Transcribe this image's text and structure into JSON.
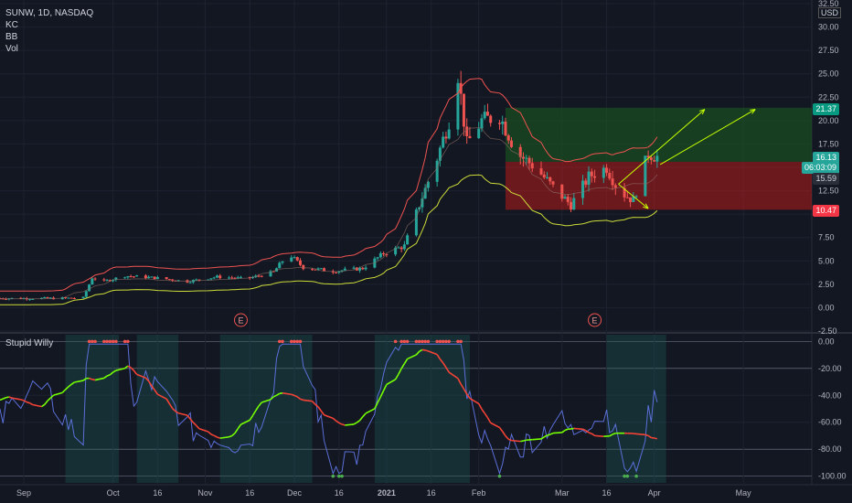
{
  "header": {
    "symbol": "SUNW, 1D, NASDAQ",
    "currency": "USD",
    "indicators": [
      "KC",
      "BB",
      "Vol"
    ],
    "sub_indicator": "Stupid Willy"
  },
  "price_tags": {
    "target": "21.37",
    "last": "16.13",
    "countdown": "06:03:09",
    "prev": "15.59",
    "stop": "10.47"
  },
  "colors": {
    "background": "#131722",
    "grid": "#1e2230",
    "up": "#26a69a",
    "down": "#ef5350",
    "kc": "#ef5350",
    "bb": "#cddc39",
    "profit_zone": "#1b5e20",
    "loss_zone": "#b71c1c",
    "arrow": "#c6ff00",
    "osc_fast": "#5b6fd8",
    "osc_slow_up": "#76ff03",
    "osc_slow_down": "#f44336"
  },
  "earnings_marker": "E",
  "chart_data": [
    {
      "type": "candlestick",
      "title": "SUNW, 1D, NASDAQ",
      "ylabel": "USD",
      "ylim": [
        -2.5,
        32.5
      ],
      "y_ticks": [
        "32.50",
        "30.00",
        "27.50",
        "25.00",
        "22.50",
        "20.00",
        "17.50",
        "15.00",
        "12.50",
        "10.00",
        "7.50",
        "5.00",
        "2.50",
        "0.00",
        "-2.50"
      ],
      "x_ticks": [
        "Sep",
        "Oct",
        "16",
        "Nov",
        "16",
        "Dec",
        "16",
        "2021",
        "16",
        "Feb",
        "Mar",
        "16",
        "Apr",
        "May"
      ],
      "x_range": [
        "2020-08-24",
        "2021-05-24"
      ],
      "price_path": [
        [
          "2020-08-24",
          1.0
        ],
        [
          "2020-09-10",
          1.0
        ],
        [
          "2020-09-21",
          1.05
        ],
        [
          "2020-09-24",
          3.2
        ],
        [
          "2020-09-28",
          2.8
        ],
        [
          "2020-10-05",
          3.4
        ],
        [
          "2020-10-15",
          3.2
        ],
        [
          "2020-10-26",
          2.8
        ],
        [
          "2020-11-05",
          3.3
        ],
        [
          "2020-11-15",
          3.1
        ],
        [
          "2020-11-24",
          3.8
        ],
        [
          "2020-11-29",
          5.8
        ],
        [
          "2020-12-04",
          4.3
        ],
        [
          "2020-12-14",
          3.9
        ],
        [
          "2020-12-24",
          4.2
        ],
        [
          "2020-12-31",
          5.8
        ],
        [
          "2021-01-07",
          6.6
        ],
        [
          "2021-01-12",
          11.0
        ],
        [
          "2021-01-18",
          16.0
        ],
        [
          "2021-01-22",
          20.0
        ],
        [
          "2021-01-25",
          25.0
        ],
        [
          "2021-01-28",
          17.5
        ],
        [
          "2021-02-02",
          20.0
        ],
        [
          "2021-02-08",
          20.5
        ],
        [
          "2021-02-14",
          16.5
        ],
        [
          "2021-02-20",
          15.0
        ],
        [
          "2021-02-27",
          12.5
        ],
        [
          "2021-03-04",
          11.0
        ],
        [
          "2021-03-10",
          14.0
        ],
        [
          "2021-03-16",
          15.0
        ],
        [
          "2021-03-20",
          12.5
        ],
        [
          "2021-03-25",
          11.5
        ],
        [
          "2021-03-30",
          16.5
        ],
        [
          "2021-04-02",
          16.13
        ]
      ],
      "keltner_upper": [
        [
          2020,
          0
        ]
      ],
      "position_tool": {
        "entry": 15.59,
        "target": 21.37,
        "stop": 10.47,
        "start": "2021-02-10",
        "end": "2021-05-24"
      },
      "earnings_dates": [
        "2020-11-13",
        "2021-03-12"
      ]
    },
    {
      "type": "line",
      "title": "Stupid Willy",
      "ylim": [
        -105,
        5
      ],
      "y_ticks": [
        "0.00",
        "-20.00",
        "-40.00",
        "-60.00",
        "-80.00",
        "-100.00"
      ],
      "levels": [
        0,
        -20,
        -80,
        -100
      ],
      "series": [],
      "highlight_ranges": [
        [
          "2020-09-15",
          "2020-10-03"
        ],
        [
          "2020-10-09",
          "2020-10-23"
        ],
        [
          "2020-11-06",
          "2020-12-07"
        ],
        [
          "2020-12-28",
          "2021-01-29"
        ],
        [
          "2021-03-16",
          "2021-04-05"
        ]
      ]
    }
  ]
}
